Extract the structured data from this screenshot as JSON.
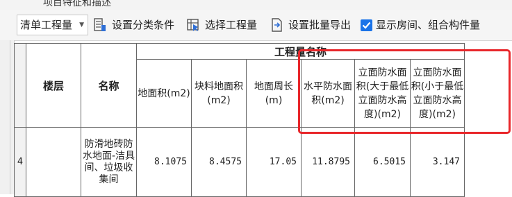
{
  "window": {
    "title": "项目特征和描述"
  },
  "toolbar": {
    "dropdown_value": "清单工程量",
    "set_category_label": "设置分类条件",
    "select_quantity_label": "选择工程量",
    "batch_export_label": "设置批量导出",
    "show_rooms_label": "显示房间、组合构件量",
    "show_rooms_checked": true
  },
  "table": {
    "header_floor": "楼层",
    "header_name": "名称",
    "header_group": "工程量名称",
    "columns": [
      "地面积(m2)",
      "块料地面积(m2)",
      "地面周长(m)",
      "水平防水面积(m2)",
      "立面防水面积(大于最低立面防水高度)(m2)",
      "立面防水面积(小于最低立面防水高度)(m2)"
    ],
    "rows": [
      {
        "row_index": "4",
        "floor": "",
        "name": "防滑地砖防水地面-洁具间、垃圾收集间",
        "values": [
          "8.1075",
          "8.4575",
          "17.05",
          "11.8795",
          "6.5015",
          "3.147"
        ]
      }
    ]
  },
  "colors": {
    "highlight_box": "#e8262a",
    "checkbox": "#1a73e8"
  }
}
